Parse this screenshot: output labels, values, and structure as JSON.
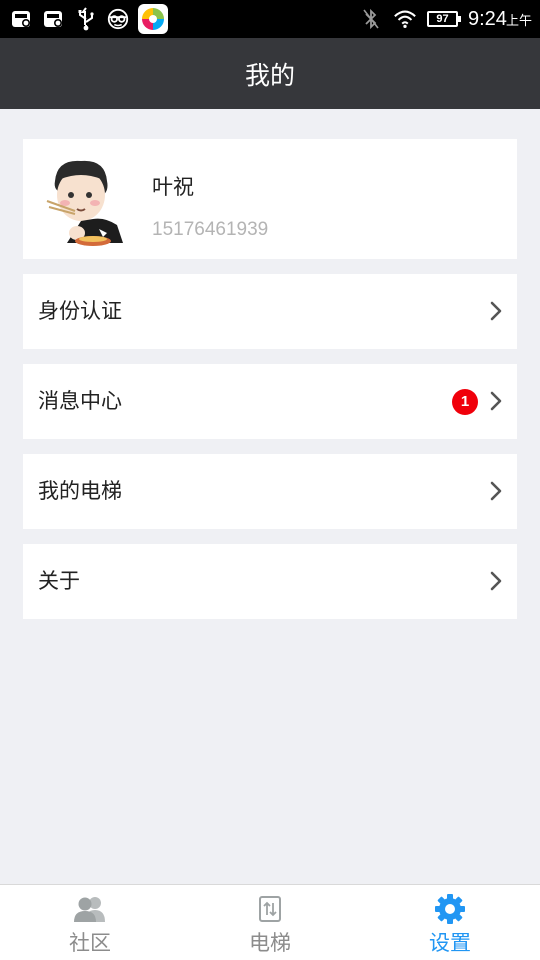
{
  "status_bar": {
    "battery": "97",
    "time": "9:24",
    "ampm": "上午",
    "icons": [
      "sim-card-icon",
      "sim-card-icon",
      "usb-icon",
      "mask-icon",
      "app-store-icon",
      "bluetooth-off-icon",
      "wifi-icon",
      "battery-icon"
    ]
  },
  "header": {
    "title": "我的"
  },
  "profile": {
    "name": "叶祝",
    "phone": "15176461939"
  },
  "menu": [
    {
      "label": "身份认证",
      "badge": null
    },
    {
      "label": "消息中心",
      "badge": "1"
    },
    {
      "label": "我的电梯",
      "badge": null
    },
    {
      "label": "关于",
      "badge": null
    }
  ],
  "tabs": [
    {
      "label": "社区",
      "icon": "community-icon",
      "active": false
    },
    {
      "label": "电梯",
      "icon": "elevator-icon",
      "active": false
    },
    {
      "label": "设置",
      "icon": "gear-icon",
      "active": true
    }
  ],
  "colors": {
    "header_bg": "#36373b",
    "accent": "#2196f3",
    "badge": "#f0000b",
    "page_bg": "#eff0f4"
  }
}
